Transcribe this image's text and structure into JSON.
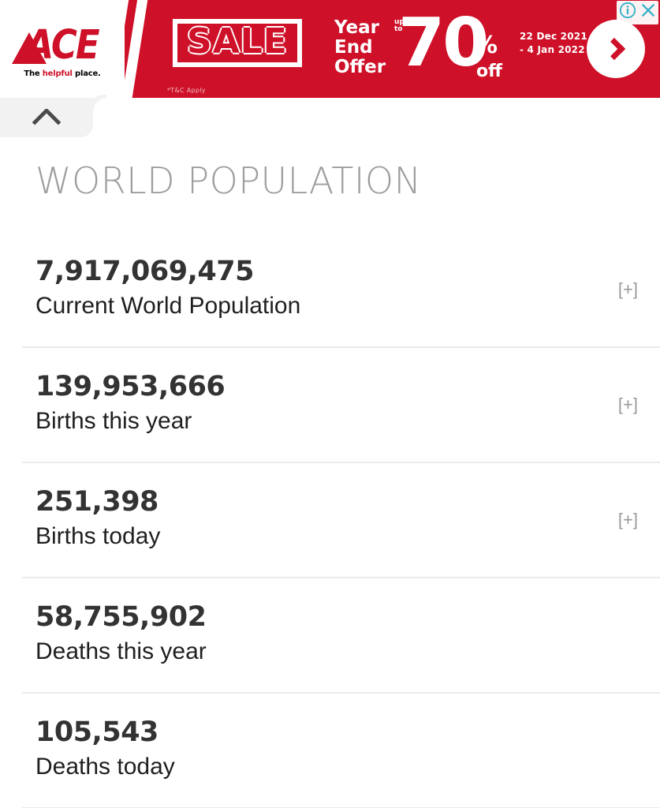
{
  "ad": {
    "brand": "ACE",
    "tagline_prefix": "The ",
    "tagline_highlight": "helpful",
    "tagline_suffix": " place.",
    "sale_label": "SALE",
    "fineprint": "*T&C Apply",
    "offer_line1": "Year",
    "offer_line2": "End",
    "offer_line3": "Offer",
    "upto": "up to",
    "percent_number": "70",
    "percent_sign": "%",
    "percent_off": "off",
    "date_line1": "22 Dec 2021",
    "date_line2": "- 4 Jan 2022",
    "arrow_icon": "chevron-right-icon",
    "info_icon": "adchoices-info-icon",
    "close_icon": "close-icon",
    "background_color": "#ce1028",
    "accent_color": "#ffffff",
    "control_icon_color": "#31b0c6"
  },
  "collapse": {
    "icon": "chevron-up-icon",
    "tab_background": "#f2f2f2"
  },
  "main": {
    "title": "WORLD POPULATION",
    "title_color": "#9e9e9e",
    "expand_symbol": "[+]",
    "counters": [
      {
        "value": "7,917,069,475",
        "label": "Current World Population",
        "expandable": true
      },
      {
        "value": "139,953,666",
        "label": "Births this year",
        "expandable": true
      },
      {
        "value": "251,398",
        "label": "Births today",
        "expandable": true
      },
      {
        "value": "58,755,902",
        "label": "Deaths this year",
        "expandable": false
      },
      {
        "value": "105,543",
        "label": "Deaths today",
        "expandable": false
      }
    ]
  }
}
